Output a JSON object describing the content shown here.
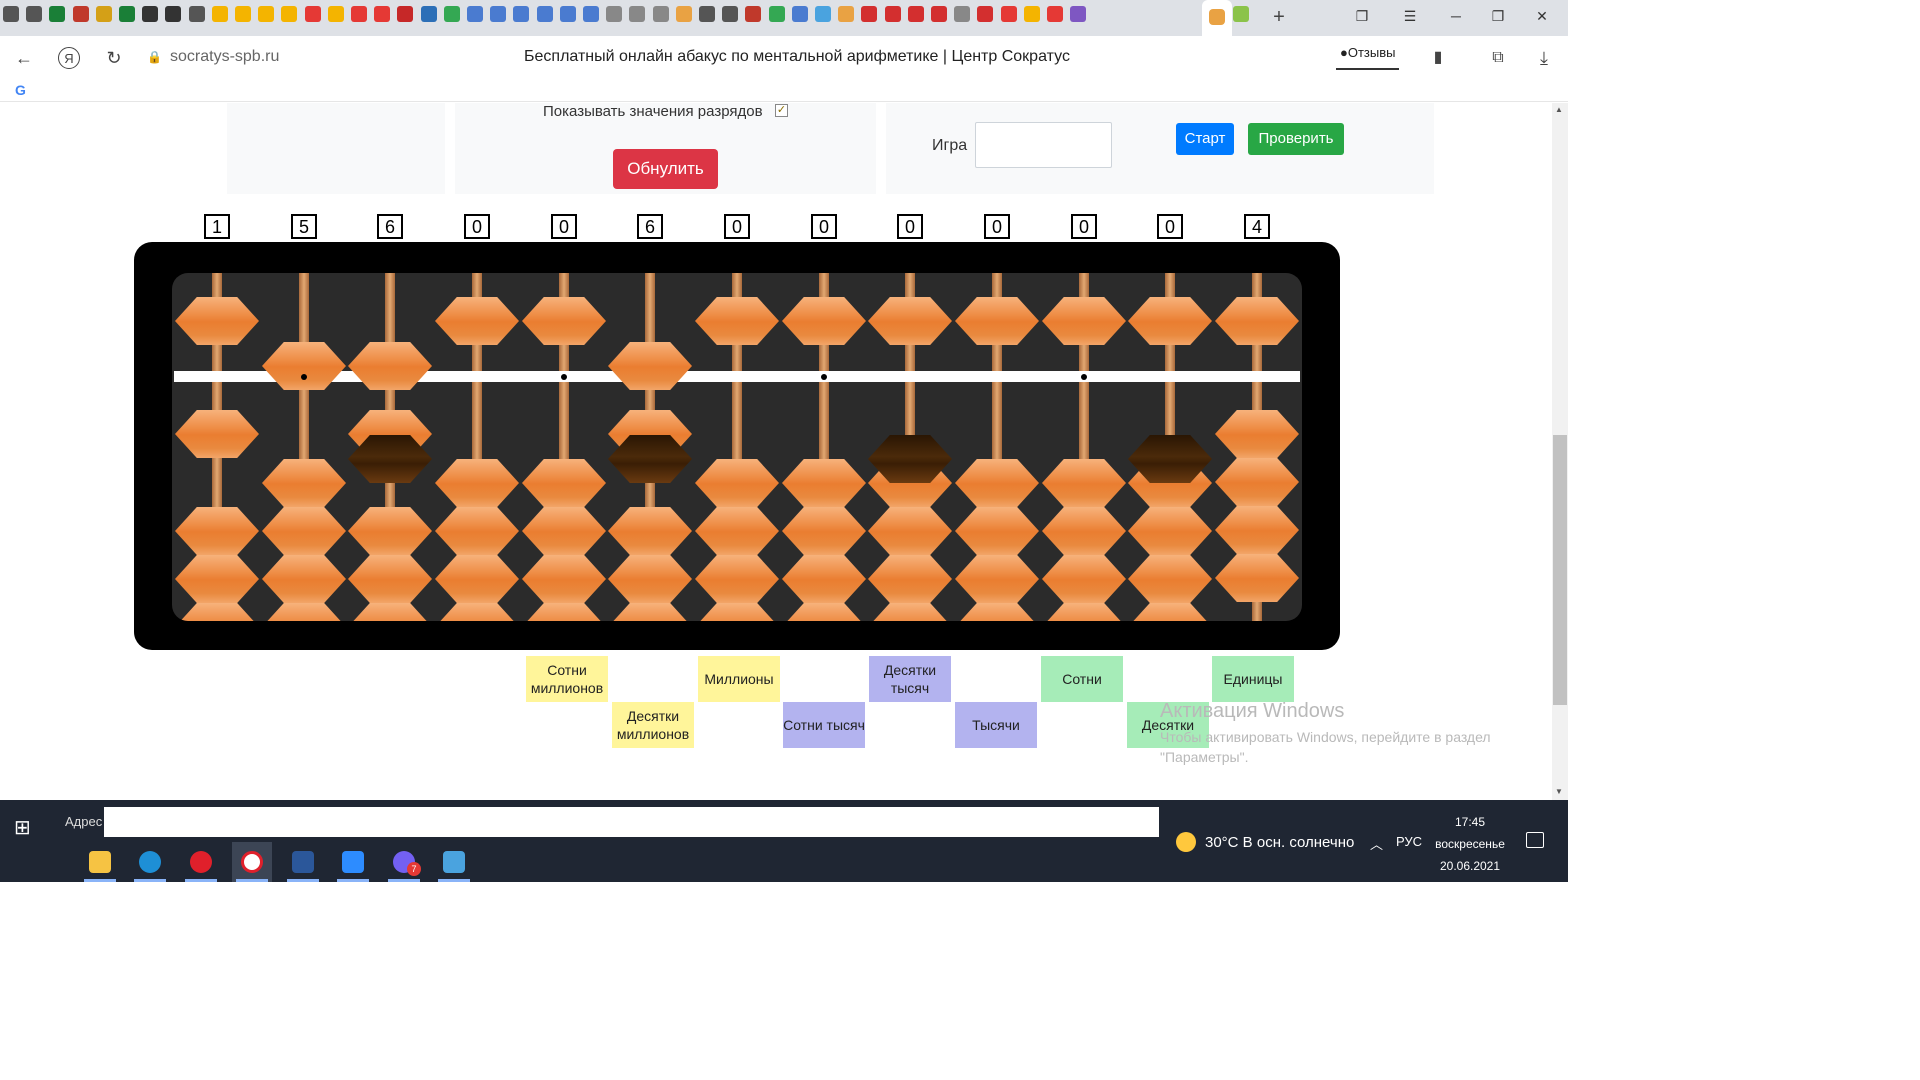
{
  "browser": {
    "domain": "socratys-spb.ru",
    "page_title": "Бесплатный онлайн абакус по ментальной арифметике | Центр Сократус",
    "reviews_label": "Отзывы"
  },
  "controls": {
    "show_values_label": "Показывать значения разрядов",
    "show_values_checked": true,
    "reset_label": "Обнулить",
    "game_label": "Игра",
    "game_value": "",
    "start_label": "Старт",
    "check_label": "Проверить"
  },
  "abacus": {
    "digits": [
      "1",
      "5",
      "6",
      "0",
      "0",
      "6",
      "0",
      "0",
      "0",
      "0",
      "0",
      "0",
      "4"
    ],
    "dark_bead_columns": [
      2,
      5,
      8,
      11
    ],
    "bead_color": "#ea7d30",
    "dark_bead_color": "#3a1e05"
  },
  "place_labels": [
    {
      "text": "Сотни миллионов",
      "color": "yellow"
    },
    {
      "text": "Десятки миллионов",
      "color": "yellow"
    },
    {
      "text": "Миллионы",
      "color": "yellow"
    },
    {
      "text": "Сотни тысяч",
      "color": "purple"
    },
    {
      "text": "Десятки тысяч",
      "color": "purple"
    },
    {
      "text": "Тысячи",
      "color": "purple"
    },
    {
      "text": "Сотни",
      "color": "green"
    },
    {
      "text": "Десятки",
      "color": "green"
    },
    {
      "text": "Единицы",
      "color": "green"
    }
  ],
  "watermark": {
    "title": "Активация Windows",
    "subtitle": "Чтобы активировать Windows, перейдите в раздел \"Параметры\"."
  },
  "taskbar": {
    "address_label": "Адрес",
    "address_value": "",
    "weather": "30°C  В осн. солнечно",
    "language": "РУС",
    "time": "17:45",
    "weekday": "воскресенье",
    "date": "20.06.2021",
    "viber_badge": "7"
  }
}
